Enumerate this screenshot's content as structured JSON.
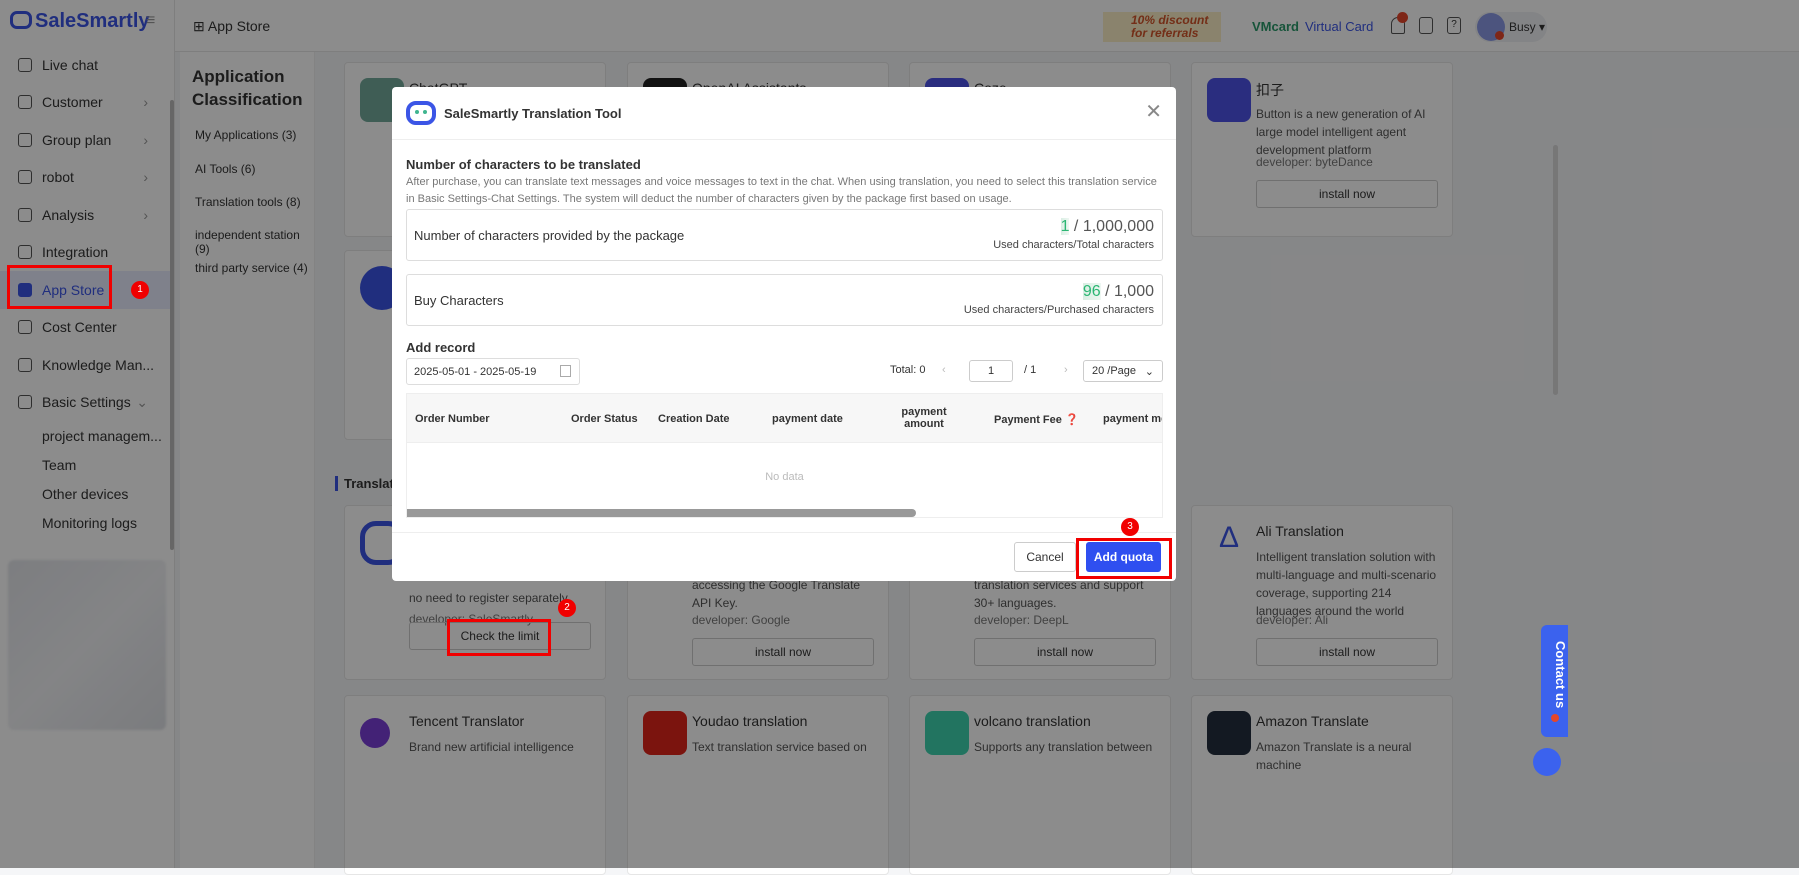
{
  "sidebar": {
    "logo": "SaleSmartly",
    "items": [
      {
        "label": "Live chat"
      },
      {
        "label": "Customer"
      },
      {
        "label": "Group plan"
      },
      {
        "label": "robot"
      },
      {
        "label": "Analysis"
      },
      {
        "label": "Integration"
      },
      {
        "label": "App Store"
      },
      {
        "label": "Cost Center"
      },
      {
        "label": "Knowledge Man..."
      },
      {
        "label": "Basic Settings"
      }
    ],
    "sub_items": [
      "project managem...",
      "Team",
      "Other devices",
      "Monitoring logs"
    ]
  },
  "topbar": {
    "breadcrumb": "App Store",
    "promo": "10% discount for referrals",
    "vmcard": "VMcard",
    "vmcard_sub": "Virtual Card",
    "user_status": "Busy",
    "notification_badge": "..."
  },
  "classification": {
    "title": "Application Classification",
    "items": [
      "My Applications (3)",
      "AI Tools (6)",
      "Translation tools (8)",
      "independent station (9)",
      "third party service (4)"
    ]
  },
  "cards_top": [
    {
      "name": "ChatGPT"
    },
    {
      "name": "OpenAI Assistants"
    },
    {
      "name": "Coze"
    },
    {
      "name": "扣子",
      "desc": "Button is a new generation of AI large model intelligent agent development platform",
      "developer": "developer: byteDance",
      "button": "install now"
    }
  ],
  "section_title": "Translati",
  "translation_cards": [
    {
      "desc": "no need to register separately",
      "developer": "developer: SaleSmartly",
      "button": "Check the limit"
    },
    {
      "desc": "accessing the Google Translate API Key.",
      "developer": "developer: Google",
      "button": "install now"
    },
    {
      "desc": "translation services and support 30+ languages.",
      "developer": "developer: DeepL",
      "button": "install now"
    },
    {
      "name": "Ali Translation",
      "desc": "Intelligent translation solution with multi-language and multi-scenario coverage, supporting 214 languages around the world",
      "developer": "developer: Ali",
      "button": "install now"
    }
  ],
  "bottom_cards": [
    {
      "name": "Tencent Translator",
      "desc": "Brand new artificial intelligence"
    },
    {
      "name": "Youdao translation",
      "desc": "Text translation service based on"
    },
    {
      "name": "volcano translation",
      "desc": "Supports any translation between"
    },
    {
      "name": "Amazon Translate",
      "desc": "Amazon Translate is a neural machine"
    }
  ],
  "modal": {
    "title": "SaleSmartly Translation Tool",
    "heading": "Number of characters to be translated",
    "description": "After purchase, you can translate text messages and voice messages to text in the chat. When using translation, you need to select this translation service in Basic Settings-Chat Settings. The system will deduct the number of characters given by the package first based on usage.",
    "package": {
      "label": "Number of characters provided by the package",
      "used": "1",
      "total": " / 1,000,000",
      "sub": "Used characters/Total characters"
    },
    "buy": {
      "label": "Buy Characters",
      "used": "96",
      "total": " / 1,000",
      "sub": "Used characters/Purchased characters"
    },
    "record_title": "Add record",
    "date_range": "2025-05-01 - 2025-05-19",
    "total": "Total:  0",
    "page": "1",
    "page_total": "/  1",
    "page_size": "20 /Page",
    "columns": [
      "Order Number",
      "Order Status",
      "Creation Date",
      "payment date",
      "payment amount",
      "Payment Fee",
      "payment me"
    ],
    "no_data": "No data",
    "cancel": "Cancel",
    "add_quota": "Add quota"
  },
  "annotations": [
    "1",
    "2",
    "3"
  ],
  "contact": "Contact us"
}
